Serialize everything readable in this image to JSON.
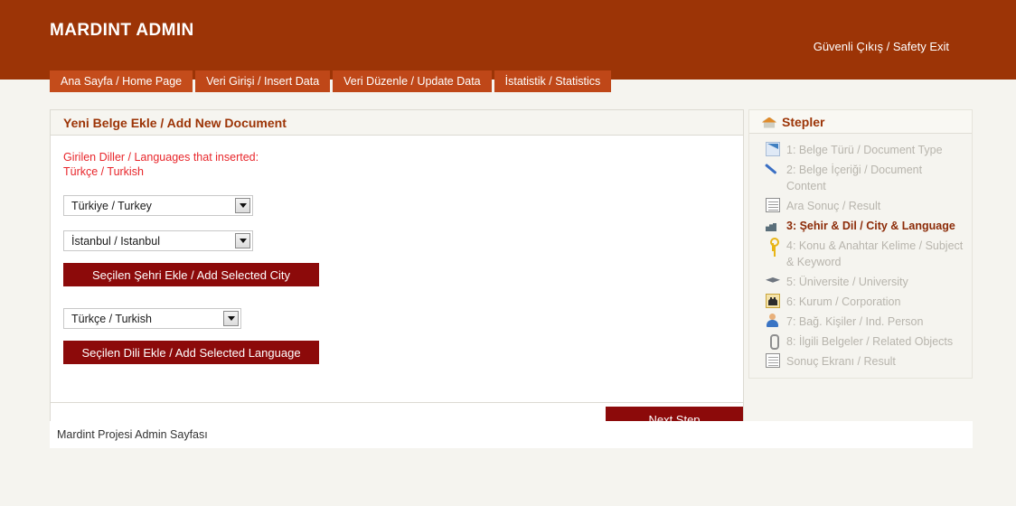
{
  "header": {
    "brand": "MARDINT ADMIN",
    "logout_label": "Güvenli Çıkış / Safety Exit",
    "background_color": "#9c3406"
  },
  "tabs": [
    {
      "label": "Ana Sayfa / Home Page",
      "active": true
    },
    {
      "label": "Veri Girişi / Insert Data",
      "active": false
    },
    {
      "label": "Veri Düzenle / Update Data",
      "active": false
    },
    {
      "label": "İstatistik / Statistics",
      "active": false
    }
  ],
  "main": {
    "panel_title": "Yeni Belge Ekle / Add New Document",
    "notice_line1": "Girilen Diller / Languages that inserted:",
    "notice_line2": "Türkçe / Turkish",
    "notice_color": "#e8262b",
    "country_select": {
      "value": "Türkiye / Turkey",
      "icon": "chevron-down-icon"
    },
    "city_select": {
      "value": "İstanbul / Istanbul",
      "icon": "chevron-down-icon"
    },
    "add_city_button": "Seçilen Şehri Ekle / Add Selected City",
    "language_select": {
      "value": "Türkçe / Turkish",
      "icon": "chevron-down-icon"
    },
    "add_language_button": "Seçilen Dili Ekle / Add Selected Language",
    "next_step_button": "Next Step",
    "button_color": "#8c0a0a"
  },
  "sidebar": {
    "title": "Stepler",
    "title_icon": "home-icon",
    "title_color": "#9c3406",
    "active_color": "#8c2b08",
    "inactive_color": "#b8b5ad",
    "items": [
      {
        "label": "1: Belge Türü / Document Type",
        "icon": "document-icon",
        "active": false
      },
      {
        "label": "2: Belge İçeriği / Document Content",
        "icon": "pen-icon",
        "active": false
      },
      {
        "label": "Ara Sonuç / Result",
        "icon": "grid-icon",
        "active": false
      },
      {
        "label": "3: Şehir & Dil / City & Language",
        "icon": "factory-icon",
        "active": true
      },
      {
        "label": "4: Konu & Anahtar Kelime / Subject & Keyword",
        "icon": "key-icon",
        "active": false
      },
      {
        "label": "5: Üniversite / University",
        "icon": "graduation-cap-icon",
        "active": false
      },
      {
        "label": "6: Kurum / Corporation",
        "icon": "corporation-icon",
        "active": false
      },
      {
        "label": "7: Bağ. Kişiler / Ind. Person",
        "icon": "person-icon",
        "active": false
      },
      {
        "label": "8: İlgili Belgeler / Related Objects",
        "icon": "paperclip-icon",
        "active": false
      },
      {
        "label": "Sonuç Ekranı / Result",
        "icon": "result-grid-icon",
        "active": false
      }
    ]
  },
  "footer": {
    "text": "Mardint Projesi Admin Sayfası"
  }
}
